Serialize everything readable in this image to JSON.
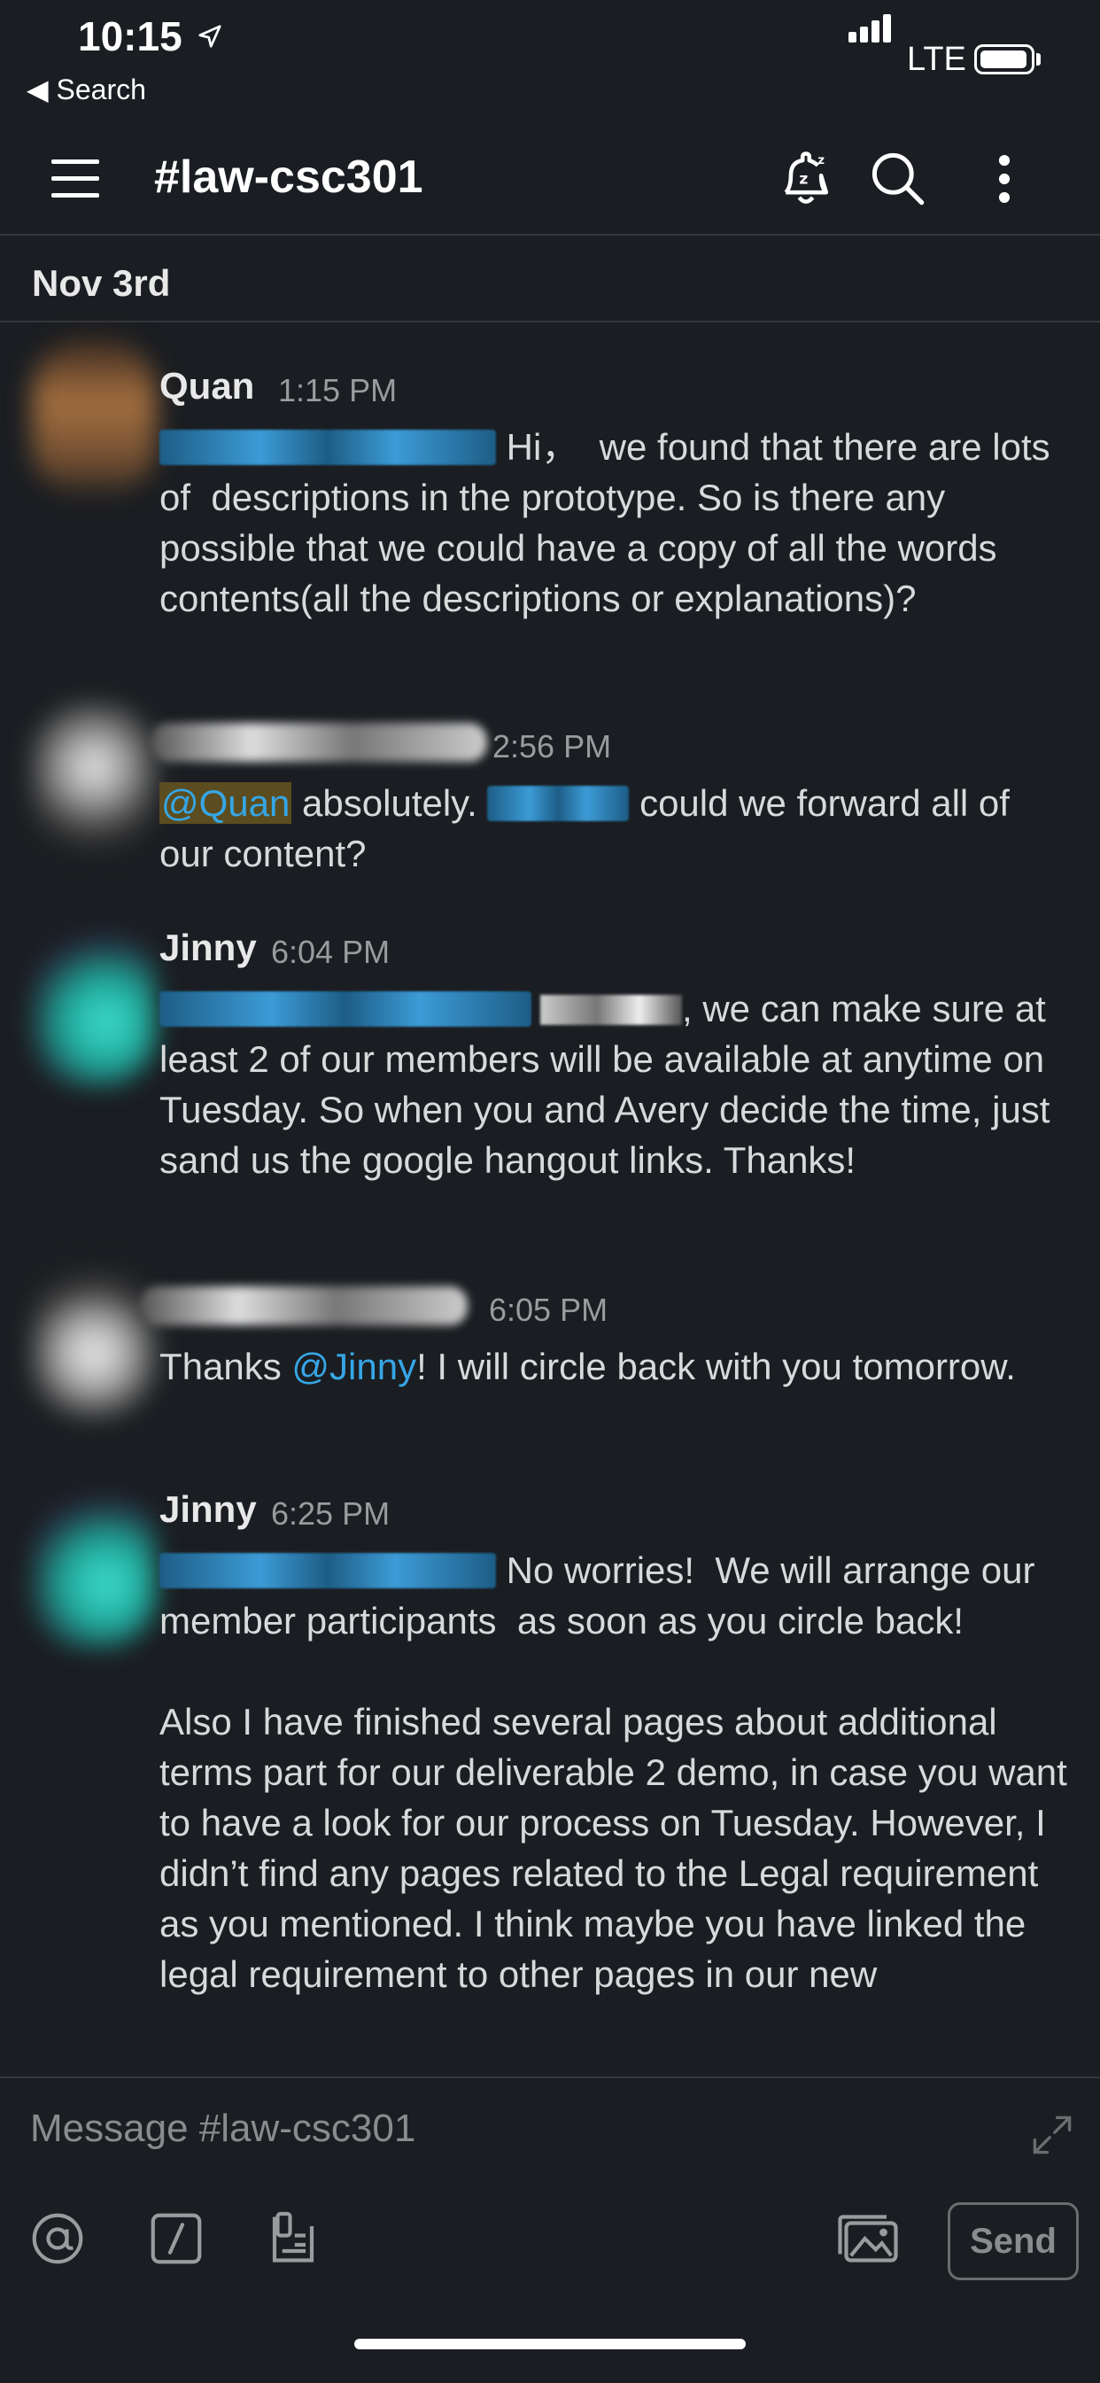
{
  "status_bar": {
    "time": "10:15",
    "back_label": "Search",
    "network": "LTE"
  },
  "header": {
    "channel": "#law-csc301"
  },
  "date_divider": "Nov 3rd",
  "messages": [
    {
      "sender": "Quan",
      "time": "1:15 PM",
      "text_pre": " Hi，  we found that there are lots of  descriptions in the prototype. So is there any possible that we could have a copy of all the words contents(all the descriptions or explanations)?"
    },
    {
      "sender": "",
      "time": "2:56 PM",
      "mention": "@Quan",
      "text_mid": " absolutely. ",
      "text_post": " could we forward all of our content?"
    },
    {
      "sender": "Jinny",
      "time": "6:04 PM",
      "text_pre": ", we can make sure at least 2 of our members will be available at anytime on Tuesday. So when you and Avery decide the time, just sand us the google hangout links. Thanks!"
    },
    {
      "sender": "",
      "time": "6:05 PM",
      "text_a": "Thanks ",
      "mention": "@Jinny",
      "text_b": "! I will circle back with you tomorrow."
    },
    {
      "sender": "Jinny",
      "time": "6:25 PM",
      "text_pre": " No worries!  We will arrange our member participants  as soon as you circle back!",
      "text_para": "Also I have finished several pages about additional terms part for our deliverable 2 demo, in case you want to have a look for our process on Tuesday. However, I didn’t find any pages related to the Legal requirement as you mentioned. I think maybe you have linked the legal requirement to other pages in our new"
    }
  ],
  "composer": {
    "placeholder": "Message #law-csc301",
    "send_label": "Send"
  },
  "icons": [
    "location-arrow-icon",
    "hamburger-icon",
    "snooze-bell-icon",
    "search-icon",
    "more-vertical-icon",
    "expand-icon",
    "at-icon",
    "slash-command-icon",
    "clipboard-icon",
    "photo-icon"
  ],
  "colors": {
    "background": "#1a1d21",
    "mention": "#36a6e6",
    "mention_highlight": "#5b4d1f"
  }
}
